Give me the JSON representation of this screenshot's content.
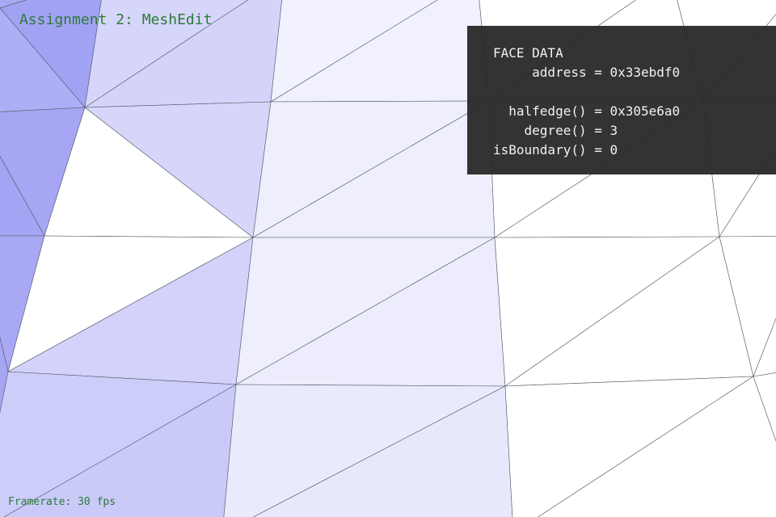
{
  "app": {
    "title": "Assignment 2: MeshEdit",
    "framerate": "Framerate: 30 fps"
  },
  "colors": {
    "title_text": "#2e7a3a",
    "panel_background": "#282828",
    "panel_text": "#f2f2f2",
    "mesh_edge": "#555a66"
  },
  "face_data": {
    "header": "FACE DATA",
    "rows": [
      "     address = 0x33ebdf0",
      "",
      "  halfedge() = 0x305e6a0",
      "    degree() = 3",
      "isBoundary() = 0"
    ]
  }
}
